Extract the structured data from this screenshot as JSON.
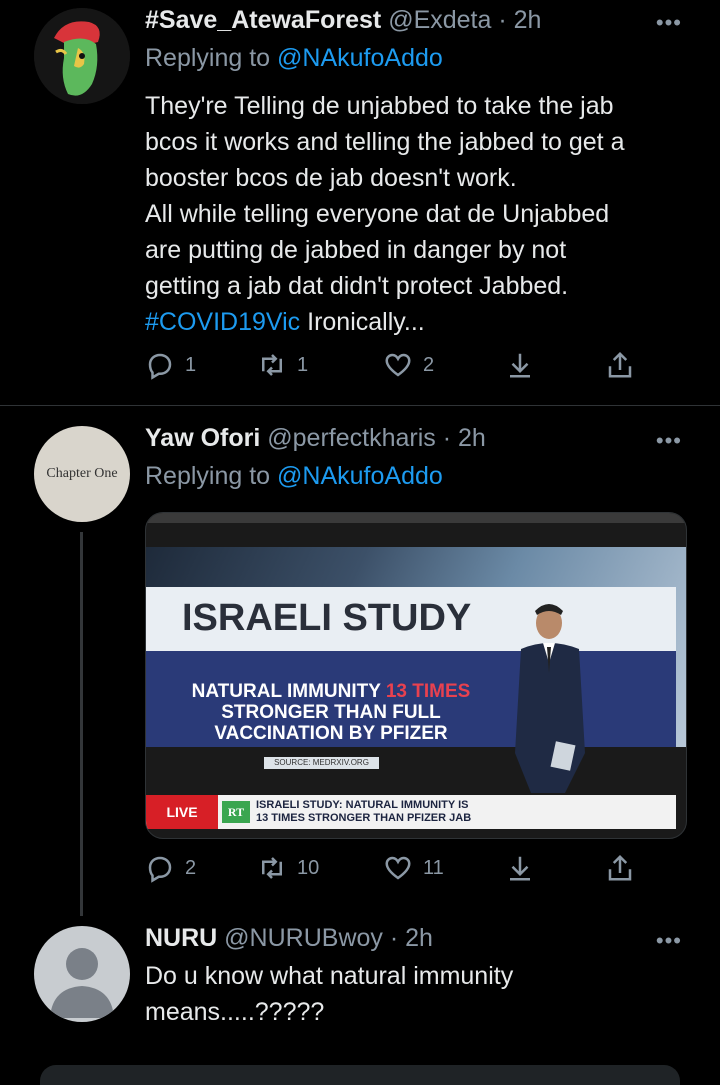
{
  "tweets": [
    {
      "name": "#Save_AtewaForest",
      "handle": "@Exdeta",
      "time": "· 2h",
      "replying_prefix": "Replying to ",
      "replying_to": "@NAkufoAddo",
      "text_lines": [
        "They're Telling de unjabbed to take the jab",
        "bcos it works and telling the jabbed to get a",
        "booster bcos de jab doesn't work.",
        "All while telling everyone dat de Unjabbed",
        "are putting de jabbed in danger by not",
        "getting a jab dat didn't protect Jabbed."
      ],
      "hashtag": "#COVID19Vic",
      "text_tail": " Ironically...",
      "replies": "1",
      "retweets": "1",
      "likes": "2"
    },
    {
      "name": "Yaw Ofori",
      "handle": "@perfectkharis",
      "time": "· 2h",
      "replying_prefix": "Replying to ",
      "replying_to": "@NAkufoAddo",
      "avatar_text": "Chapter One",
      "media": {
        "headline": "ISRAELI STUDY",
        "claim_line1_a": "NATURAL IMMUNITY ",
        "claim_line1_b": "13 TIMES",
        "claim_line2": "STRONGER THAN FULL",
        "claim_line3": "VACCINATION BY PFIZER",
        "source": "SOURCE: MEDRXIV.ORG",
        "live": "LIVE",
        "channel": "RT",
        "ticker_line1": "ISRAELI STUDY: NATURAL IMMUNITY IS",
        "ticker_line2": "13 TIMES STRONGER THAN PFIZER JAB"
      },
      "replies": "2",
      "retweets": "10",
      "likes": "11"
    },
    {
      "name": "NURU",
      "handle": "@NURUBwoy",
      "time": "· 2h",
      "text_lines": [
        "Do u know what natural immunity",
        "means.....?????"
      ]
    }
  ],
  "more_label": "•••",
  "colors": {
    "accent": "#1d9bf0",
    "muted": "#8b98a5",
    "text": "#e7e9ea"
  }
}
